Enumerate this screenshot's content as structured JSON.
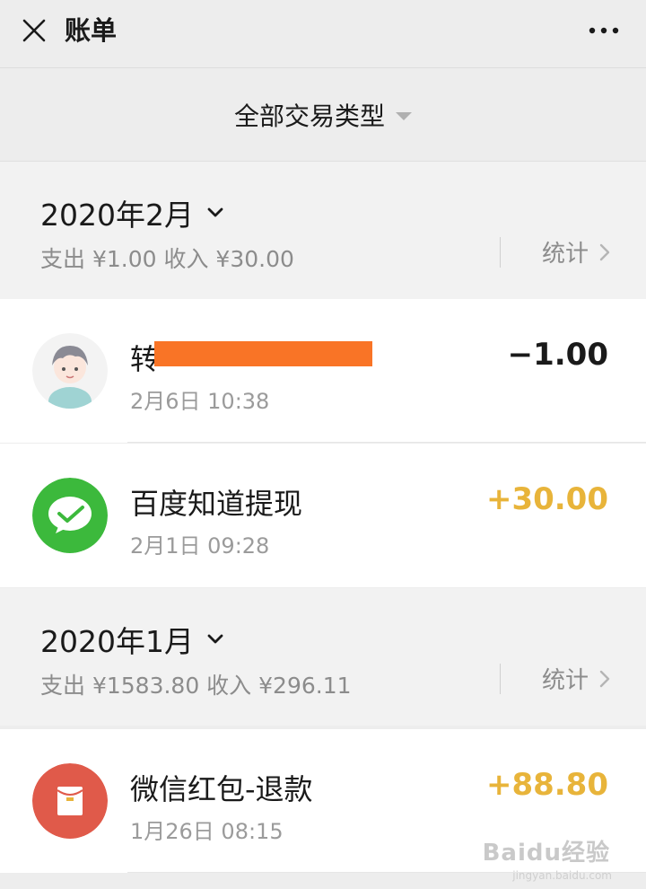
{
  "header": {
    "title": "账单",
    "close_icon": "close-icon",
    "more_icon": "more-icon"
  },
  "filter": {
    "label": "全部交易类型"
  },
  "months": [
    {
      "title": "2020年2月",
      "summary": "支出 ¥1.00 收入 ¥30.00",
      "stats_label": "统计",
      "transactions": [
        {
          "title": "转",
          "time": "2月6日 10:38",
          "amount": "−1.00",
          "icon": "avatar-icon",
          "redacted": true
        },
        {
          "title": "百度知道提现",
          "time": "2月1日 09:28",
          "amount": "+30.00",
          "icon": "wechat-pay-icon"
        }
      ]
    },
    {
      "title": "2020年1月",
      "summary": "支出 ¥1583.80 收入 ¥296.11",
      "stats_label": "统计",
      "transactions": [
        {
          "title": "微信红包-退款",
          "time": "1月26日 08:15",
          "amount": "+88.80",
          "icon": "red-packet-icon"
        }
      ]
    }
  ],
  "colors": {
    "positive": "#e8b43a",
    "wechat_green": "#3cb93c",
    "red_packet": "#e05a4a",
    "redaction": "#f97426"
  },
  "watermark": {
    "text": "Baidu经验",
    "sub": "jingyan.baidu.com"
  }
}
